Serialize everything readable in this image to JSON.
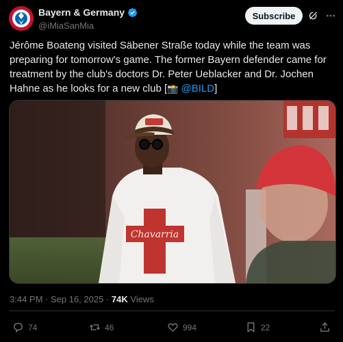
{
  "author": {
    "display_name": "Bayern & Germany",
    "handle": "@iMiaSanMia"
  },
  "subscribe_label": "Subscribe",
  "tweet": {
    "text_main": "Jérôme Boateng visited Säbener Straße today while the team was preparing for tomorrow's game. The former Bayern defender came for treatment by the club's doctors Dr. Peter Ueblacker and Dr. Jochen Hahne as he looks for a new club [",
    "text_link": "@BILD",
    "text_end": "]",
    "camera_emoji": "📸"
  },
  "meta": {
    "time": "3:44 PM",
    "sep1": " · ",
    "date": "Sep 16, 2025",
    "sep2": " · ",
    "views_count": "74K",
    "views_label": " Views"
  },
  "actions": {
    "replies": "74",
    "reposts": "46",
    "likes": "994",
    "bookmarks": "22"
  },
  "media": {
    "shirt_text": "Chavarria"
  },
  "icons": {
    "verified": "verified-badge-icon",
    "grok": "grok-icon",
    "more": "more-icon",
    "reply": "reply-icon",
    "repost": "repost-icon",
    "like": "like-icon",
    "bookmark": "bookmark-icon",
    "share": "share-icon"
  },
  "colors": {
    "background": "#000000",
    "text": "#e7e9ea",
    "muted": "#71767b",
    "link": "#1d9bf0",
    "bayern_red": "#c8102e"
  }
}
